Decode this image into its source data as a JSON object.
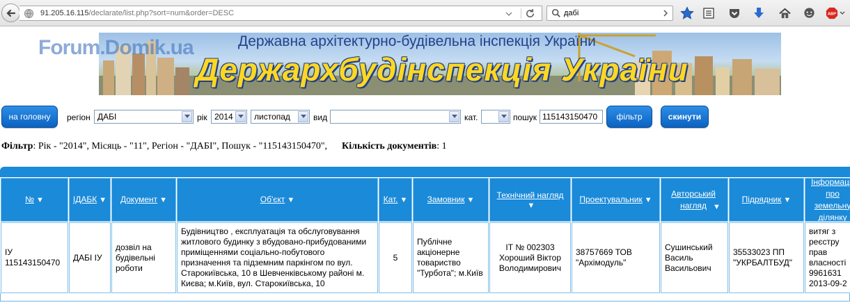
{
  "browser": {
    "url_host": "91.205.16.115",
    "url_path": "/declarate/list.php?sort=num&order=DESC",
    "search_query": "дабі",
    "adblock_label": "ABP"
  },
  "header": {
    "watermark": "Forum.Domik.ua",
    "subtitle": "Державна архітектурно-будівельна інспекція України",
    "title": "Держархбудінспекція України"
  },
  "filters": {
    "home_button": "на головну",
    "region_label": "регіон",
    "region_value": "ДАБІ",
    "year_label": "рік",
    "year_value": "2014",
    "month_value": "листопад",
    "type_label": "вид",
    "type_value": "",
    "category_label": "кат.",
    "category_value": "",
    "search_label": "пошук",
    "search_value": "115143150470",
    "filter_button": "фільтр",
    "reset_button": "скинути"
  },
  "summary": {
    "filter_label": "Фільтр",
    "filter_text": ": Рік - \"2014\", Місяць - \"11\", Регіон - \"ДАБІ\", Пошук - \"115143150470\",",
    "count_label": "Кількість документів",
    "count_value": ": 1"
  },
  "table": {
    "columns": [
      "№",
      "ІДАБК",
      "Документ",
      "Об'єкт",
      "Кат.",
      "Замовник",
      "Технічний нагляд",
      "Проектувальник",
      "Авторський нагляд",
      "Підрядник",
      "Інформація про земельну ділянку"
    ],
    "row": {
      "num": "ІУ 115143150470",
      "idabk": "ДАБІ ІУ",
      "document": "дозвіл на будівельні роботи",
      "object": "Будівництво , експлуатація та обслуговування житлового будинку з вбудовано-прибудованими приміщеннями соціально-побутового призначення та підземним паркінгом по вул. Старокиївська, 10 в Шевченківському районі м. Києва; м.Київ, вул. Старокиївська, 10",
      "category": "5",
      "customer": "Публічне акціонерне товариство \"Турбота\"; м.Київ",
      "tech_supervision": "ІТ № 002303 Хороший Віктор Володимирович",
      "designer": "38757669 ТОВ \"Архімодуль\"",
      "author_supervision": "Сушинський Василь Васильович",
      "contractor": "35533023 ПП \"УКРБАЛТБУД\"",
      "land_info": "витяг з реєстру прав власності 9961631 2013-09-2"
    }
  },
  "colors": {
    "accent": "#1a8ad9",
    "button": "#0b62c2",
    "title_yellow": "#ffd722"
  }
}
